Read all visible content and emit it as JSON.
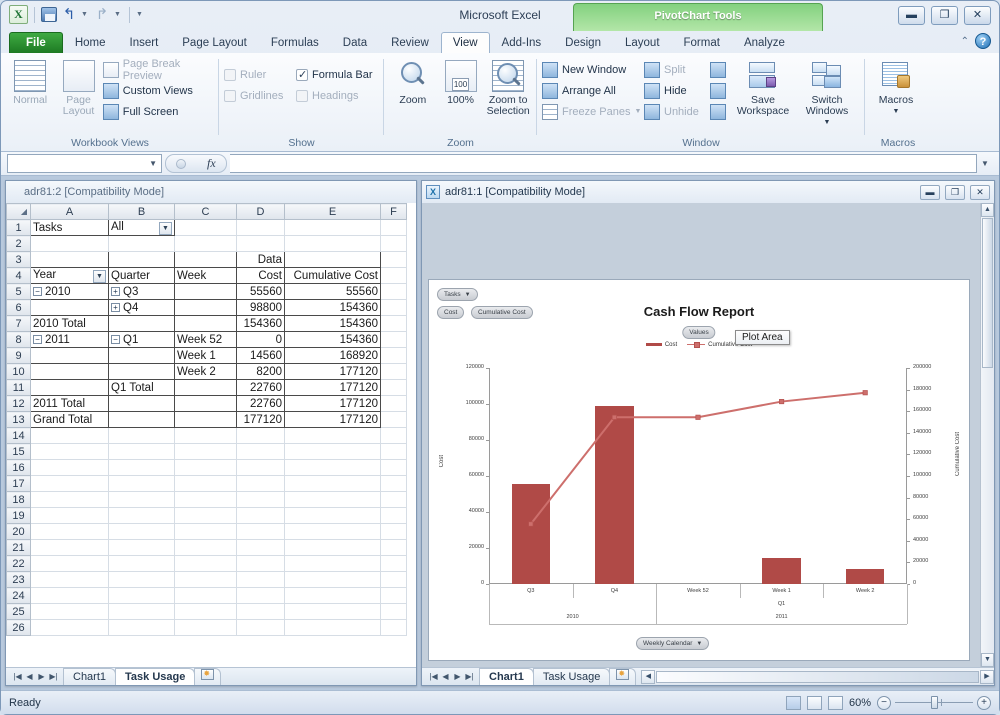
{
  "titlebar": {
    "app_title": "Microsoft Excel",
    "contextual_tab_title": "PivotChart Tools",
    "quick_access": [
      "save-icon",
      "undo-icon",
      "redo-icon",
      "customize-qat-icon"
    ],
    "window_buttons": [
      "minimize",
      "restore",
      "close"
    ]
  },
  "ribbon": {
    "tabs": [
      "File",
      "Home",
      "Insert",
      "Page Layout",
      "Formulas",
      "Data",
      "Review",
      "View",
      "Add-Ins"
    ],
    "contextual_tabs": [
      "Design",
      "Layout",
      "Format",
      "Analyze"
    ],
    "active_tab": "View",
    "help_label": "?",
    "groups": [
      {
        "name": "Workbook Views",
        "label": "Workbook Views",
        "big_buttons": [
          {
            "label": "Normal",
            "icon": "normal-view-icon",
            "disabled": true
          },
          {
            "label": "Page Layout",
            "icon": "page-layout-icon",
            "disabled": true
          }
        ],
        "small_items": [
          {
            "label": "Page Break Preview",
            "icon": "page-break-preview-icon",
            "disabled": true
          },
          {
            "label": "Custom Views",
            "icon": "custom-views-icon",
            "disabled": false
          },
          {
            "label": "Full Screen",
            "icon": "full-screen-icon",
            "disabled": false
          }
        ]
      },
      {
        "name": "Show",
        "label": "Show",
        "checkboxes": [
          {
            "label": "Ruler",
            "checked": false,
            "disabled": true
          },
          {
            "label": "Formula Bar",
            "checked": true,
            "disabled": false
          },
          {
            "label": "Gridlines",
            "checked": false,
            "disabled": true
          },
          {
            "label": "Headings",
            "checked": false,
            "disabled": true
          }
        ]
      },
      {
        "name": "Zoom",
        "label": "Zoom",
        "big_buttons": [
          {
            "label": "Zoom",
            "icon": "zoom-magnifier-icon",
            "disabled": false
          },
          {
            "label": "100%",
            "icon": "zoom-100-icon",
            "disabled": false
          },
          {
            "label": "Zoom to Selection",
            "icon": "zoom-to-selection-icon",
            "disabled": false
          }
        ]
      },
      {
        "name": "Window",
        "label": "Window",
        "small_items": [
          {
            "label": "New Window",
            "icon": "new-window-icon",
            "disabled": false
          },
          {
            "label": "Arrange All",
            "icon": "arrange-all-icon",
            "disabled": false
          },
          {
            "label": "Freeze Panes",
            "icon": "freeze-panes-icon",
            "disabled": true,
            "dropdown": true
          },
          {
            "label": "Split",
            "icon": "split-icon",
            "disabled": true
          },
          {
            "label": "Hide",
            "icon": "hide-icon",
            "disabled": false
          },
          {
            "label": "Unhide",
            "icon": "unhide-icon",
            "disabled": true
          }
        ],
        "icon_column": [
          "view-side-by-side-icon",
          "synchronous-scrolling-icon",
          "reset-window-position-icon"
        ],
        "big_buttons": [
          {
            "label": "Save Workspace",
            "icon": "save-workspace-icon",
            "disabled": false
          },
          {
            "label": "Switch Windows",
            "icon": "switch-windows-icon",
            "disabled": false,
            "dropdown": true
          }
        ]
      },
      {
        "name": "Macros",
        "label": "Macros",
        "big_buttons": [
          {
            "label": "Macros",
            "icon": "macros-icon",
            "disabled": false,
            "dropdown": true
          }
        ]
      }
    ]
  },
  "formula_bar": {
    "name_box_value": "",
    "formula_value": "",
    "fx_label": "fx"
  },
  "sheet_window": {
    "title": "adr81:2  [Compatibility Mode]",
    "window_buttons": [],
    "columns": [
      "A",
      "B",
      "C",
      "D",
      "E",
      "F"
    ],
    "rows": [
      {
        "n": "1",
        "a": "Tasks",
        "b": "All",
        "b_filter": true,
        "c": "",
        "d": "",
        "e": ""
      },
      {
        "n": "2",
        "a": "",
        "b": "",
        "c": "",
        "d": "",
        "e": ""
      },
      {
        "n": "3",
        "a": "",
        "b": "",
        "c": "",
        "d": "Data",
        "e": ""
      },
      {
        "n": "4",
        "a": "Year",
        "a_filter": true,
        "b": "Quarter",
        "c": "Week",
        "d": "Cost",
        "e": "Cumulative Cost"
      },
      {
        "n": "5",
        "a": "2010",
        "a_toggle": "minus",
        "b": "Q3",
        "b_toggle": "plus",
        "c": "",
        "d": "55560",
        "e": "55560"
      },
      {
        "n": "6",
        "a": "",
        "b": "Q4",
        "b_toggle": "plus",
        "c": "",
        "d": "98800",
        "e": "154360"
      },
      {
        "n": "7",
        "a": "2010 Total",
        "b": "",
        "c": "",
        "d": "154360",
        "e": "154360"
      },
      {
        "n": "8",
        "a": "2011",
        "a_toggle": "minus",
        "b": "Q1",
        "b_toggle": "minus",
        "c": "Week 52",
        "d": "0",
        "e": "154360"
      },
      {
        "n": "9",
        "a": "",
        "b": "",
        "c": "Week 1",
        "d": "14560",
        "e": "168920"
      },
      {
        "n": "10",
        "a": "",
        "b": "",
        "c": "Week 2",
        "d": "8200",
        "e": "177120"
      },
      {
        "n": "11",
        "a": "",
        "b": "Q1 Total",
        "c": "",
        "d": "22760",
        "e": "177120"
      },
      {
        "n": "12",
        "a": "2011 Total",
        "b": "",
        "c": "",
        "d": "22760",
        "e": "177120"
      },
      {
        "n": "13",
        "a": "Grand Total",
        "b": "",
        "c": "",
        "d": "177120",
        "e": "177120"
      },
      {
        "n": "14"
      },
      {
        "n": "15"
      },
      {
        "n": "16"
      },
      {
        "n": "17"
      },
      {
        "n": "18"
      },
      {
        "n": "19"
      },
      {
        "n": "20"
      },
      {
        "n": "21"
      },
      {
        "n": "22"
      },
      {
        "n": "23"
      },
      {
        "n": "24"
      },
      {
        "n": "25"
      },
      {
        "n": "26"
      }
    ],
    "sheet_tabs": [
      {
        "label": "Chart1",
        "active": false
      },
      {
        "label": "Task Usage",
        "active": true
      }
    ],
    "new_sheet_label": ""
  },
  "chart_window": {
    "title": "adr81:1  [Compatibility Mode]",
    "window_buttons": [
      "minimize",
      "restore",
      "close"
    ],
    "field_buttons": {
      "report_filter": "Tasks",
      "series": [
        "Cost",
        "Cumulative Cost"
      ],
      "values_label": "Values",
      "axis_field": "Weekly Calendar"
    },
    "tooltip": "Plot Area",
    "sheet_tabs": [
      {
        "label": "Chart1",
        "active": true
      },
      {
        "label": "Task Usage",
        "active": false
      }
    ]
  },
  "chart_data": {
    "type": "bar",
    "title": "Cash Flow Report",
    "categories": [
      "Q3",
      "Q4",
      "Week 52",
      "Week 1",
      "Week 2"
    ],
    "group_level_2": [
      {
        "label": "Q1",
        "span": [
          2,
          4
        ]
      }
    ],
    "group_level_3": [
      {
        "label": "2010",
        "span": [
          0,
          1
        ]
      },
      {
        "label": "2011",
        "span": [
          2,
          4
        ]
      }
    ],
    "series": [
      {
        "name": "Cost",
        "type": "bar",
        "axis": "left",
        "color": "#b04a47",
        "values": [
          55560,
          98800,
          0,
          14560,
          8200
        ]
      },
      {
        "name": "Cumulative Cost",
        "type": "line",
        "axis": "right",
        "color": "#cd6f6c",
        "values": [
          55560,
          154360,
          154360,
          168920,
          177120
        ]
      }
    ],
    "xlabel": "",
    "ylabel": "Cost",
    "y2label": "Cumulative Cost",
    "ylim": [
      0,
      120000
    ],
    "y2lim": [
      0,
      200000
    ],
    "yticks": [
      "0",
      "20000",
      "40000",
      "60000",
      "80000",
      "100000",
      "120000"
    ],
    "y2ticks": [
      "0",
      "20000",
      "40000",
      "60000",
      "80000",
      "100000",
      "120000",
      "140000",
      "160000",
      "180000",
      "200000"
    ],
    "grid": false,
    "legend": [
      "Cost",
      "Cumulative Cost"
    ],
    "legend_position": "top"
  },
  "status_bar": {
    "status_text": "Ready",
    "view_buttons": [
      "normal-view-icon",
      "page-layout-view-icon",
      "page-break-preview-icon"
    ],
    "zoom_level": "60%",
    "zoom_out_label": "−",
    "zoom_in_label": "+"
  }
}
